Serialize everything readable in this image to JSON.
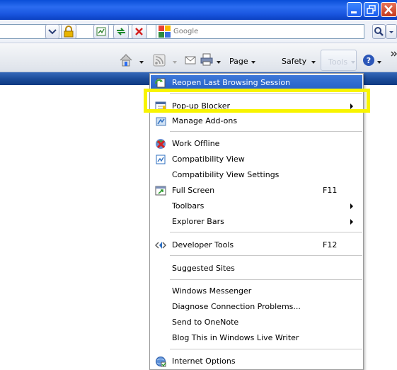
{
  "search": {
    "placeholder": "Google"
  },
  "command_bar": {
    "page_label": "Page",
    "safety_label": "Safety",
    "tools_label": "Tools"
  },
  "tools_menu": {
    "items": [
      {
        "label": "Reopen Last Browsing Session",
        "icon": "reopen-session-icon",
        "highlighted": true
      },
      {
        "label": "Pop-up Blocker",
        "icon": "popup-blocker-icon",
        "submenu": true
      },
      {
        "label": "Manage Add-ons",
        "icon": "manage-addons-icon"
      },
      {
        "label": "Work Offline",
        "icon": "work-offline-icon"
      },
      {
        "label": "Compatibility View",
        "icon": "compatibility-view-icon"
      },
      {
        "label": "Compatibility View Settings"
      },
      {
        "label": "Full Screen",
        "icon": "full-screen-icon",
        "shortcut": "F11"
      },
      {
        "label": "Toolbars",
        "submenu": true
      },
      {
        "label": "Explorer Bars",
        "submenu": true
      },
      {
        "label": "Developer Tools",
        "icon": "developer-tools-icon",
        "shortcut": "F12"
      },
      {
        "label": "Suggested Sites"
      },
      {
        "label": "Windows Messenger"
      },
      {
        "label": "Diagnose Connection Problems..."
      },
      {
        "label": "Send to OneNote"
      },
      {
        "label": "Blog This in Windows Live Writer"
      },
      {
        "label": "Internet Options",
        "icon": "internet-options-icon"
      }
    ]
  },
  "colors": {
    "titlebar": "#1a56e0",
    "menu_highlight": "#2360c6",
    "annotation_box": "#f8f400"
  }
}
